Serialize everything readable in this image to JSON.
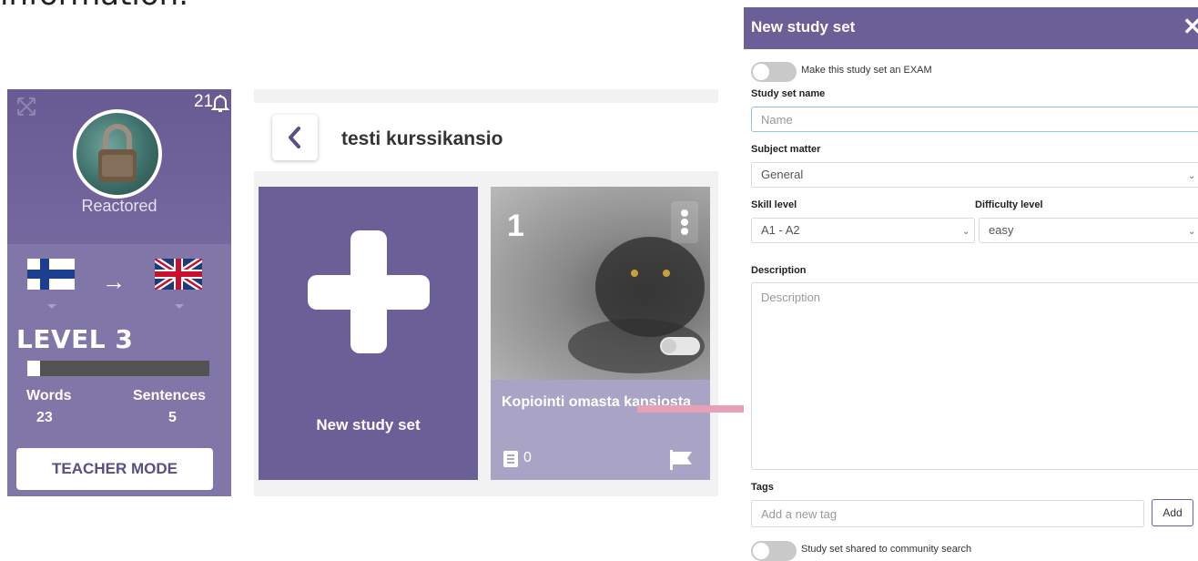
{
  "background_text": "information.",
  "profile": {
    "notification_count": "21",
    "user_name": "Reactored",
    "level": "LEVEL 3",
    "level_progress_fraction": 0.07,
    "stats": [
      {
        "label": "Words",
        "value": "23"
      },
      {
        "label": "Sentences",
        "value": "5"
      }
    ],
    "teacher_mode_label": "TEACHER MODE"
  },
  "folder": {
    "title": "testi kurssikansio",
    "new_card_label": "New study set",
    "sets": [
      {
        "number": "1",
        "title": "Kopiointi omasta kansiosta",
        "word_count": "0"
      }
    ]
  },
  "modal": {
    "title": "New study set",
    "exam_toggle_label": "Make this study set an EXAM",
    "name_label": "Study set name",
    "name_placeholder": "Name",
    "subject_label": "Subject matter",
    "subject_value": "General",
    "skill_label": "Skill level",
    "skill_value": "A1 - A2",
    "difficulty_label": "Difficulty level",
    "difficulty_value": "easy",
    "description_label": "Description",
    "description_placeholder": "Description",
    "tags_label": "Tags",
    "tags_placeholder": "Add a new tag",
    "add_label": "Add",
    "share_toggle_label": "Study set shared to community search"
  },
  "colors": {
    "purple": "#6b5f98",
    "panel_light": "#8176a8",
    "arrow_pink": "#e8a0b4"
  }
}
